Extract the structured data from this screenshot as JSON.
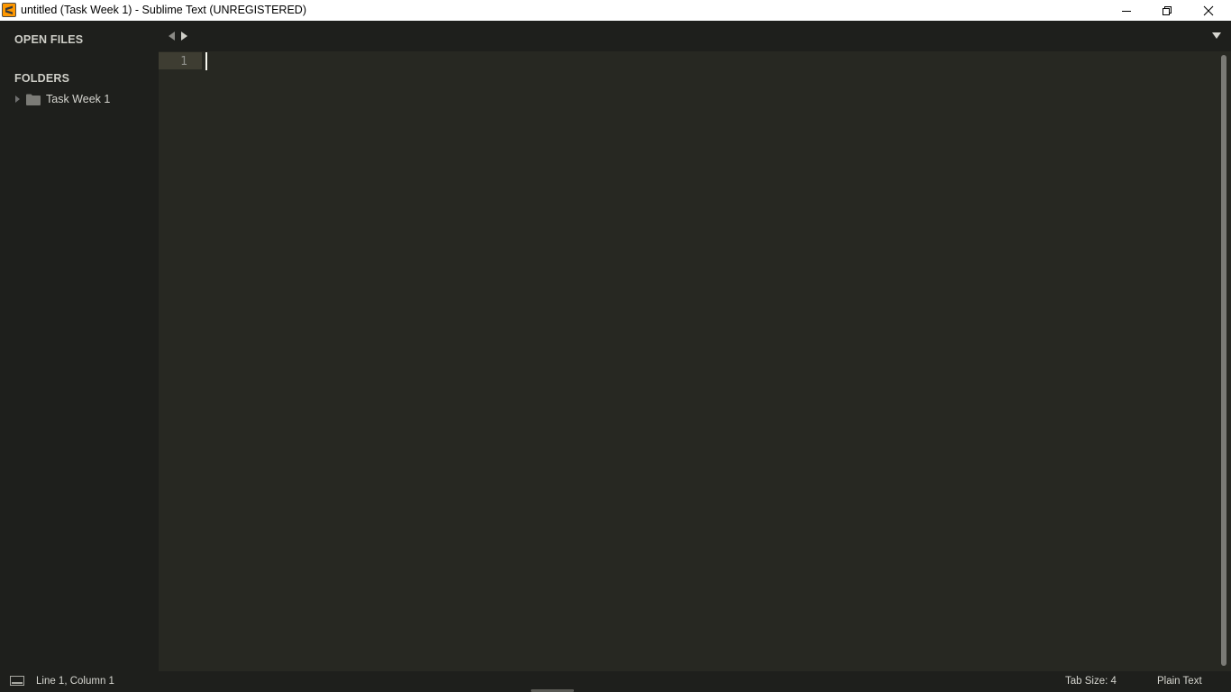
{
  "window": {
    "title": "untitled (Task Week 1) - Sublime Text (UNREGISTERED)",
    "app_icon": "sublime-text-icon",
    "controls": [
      "minimize-icon",
      "restore-icon",
      "close-icon"
    ]
  },
  "sidebar": {
    "open_files_heading": "OPEN FILES",
    "folders_heading": "FOLDERS",
    "folders": [
      {
        "label": "Task Week 1",
        "expanded": false,
        "icon": "folder-icon"
      }
    ]
  },
  "tabs": {
    "nav_icons": [
      "chevron-left-icon",
      "chevron-right-icon"
    ],
    "menu_icon": "tab-list-icon"
  },
  "editor": {
    "line_numbers": [
      "1"
    ],
    "content": ""
  },
  "status_bar": {
    "position": "Line 1, Column 1",
    "tab_size": "Tab Size: 4",
    "syntax": "Plain Text",
    "panel_icon": "panel-toggle-icon"
  },
  "colors": {
    "editor_bg": "#272822",
    "sidebar_bg": "#1e1f1c",
    "gutter_highlight": "#3e3d32",
    "app_icon_accent": "#ff9800"
  }
}
